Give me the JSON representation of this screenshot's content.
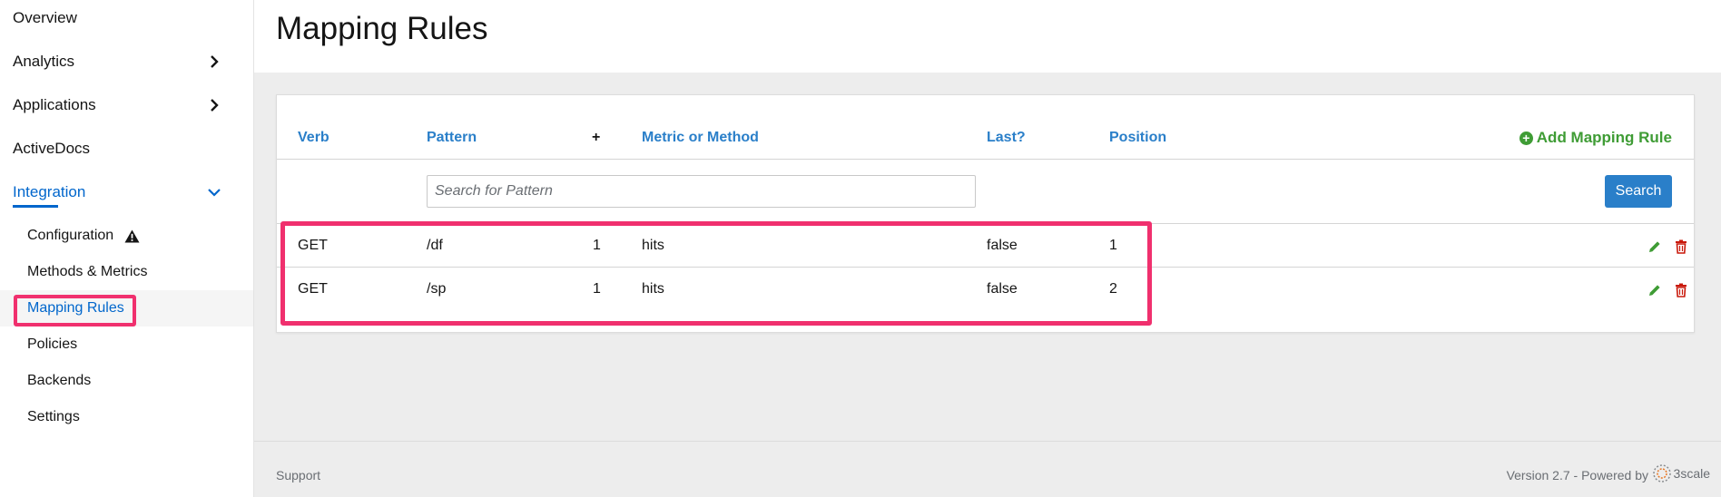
{
  "sidebar": {
    "items": [
      {
        "label": "Overview"
      },
      {
        "label": "Analytics"
      },
      {
        "label": "Applications"
      },
      {
        "label": "ActiveDocs"
      },
      {
        "label": "Integration"
      }
    ],
    "sub_items": [
      {
        "label": "Configuration"
      },
      {
        "label": "Methods & Metrics"
      },
      {
        "label": "Mapping Rules"
      },
      {
        "label": "Policies"
      },
      {
        "label": "Backends"
      },
      {
        "label": "Settings"
      }
    ]
  },
  "page": {
    "title": "Mapping Rules"
  },
  "table": {
    "columns": {
      "verb": "Verb",
      "pattern": "Pattern",
      "plus": "+",
      "metric": "Metric or Method",
      "last": "Last?",
      "position": "Position"
    },
    "add_label": "Add Mapping Rule",
    "search_placeholder": "Search for Pattern",
    "search_button": "Search",
    "rows": [
      {
        "verb": "GET",
        "pattern": "/df",
        "delta": "1",
        "metric": "hits",
        "last": "false",
        "position": "1"
      },
      {
        "verb": "GET",
        "pattern": "/sp",
        "delta": "1",
        "metric": "hits",
        "last": "false",
        "position": "2"
      }
    ]
  },
  "footer": {
    "support": "Support",
    "version": "Version 2.7 - Powered by",
    "logo_text": "3scale"
  },
  "colors": {
    "accent": "#0066cc",
    "header_link": "#2a7fc9",
    "add_green": "#3f9c35",
    "delete_red": "#c9190b",
    "highlight": "#f0306e"
  }
}
